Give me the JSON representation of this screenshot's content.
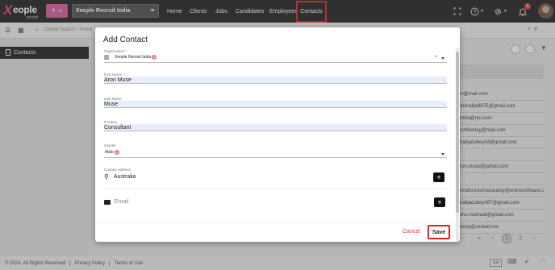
{
  "app": {
    "logo_letter": "X",
    "logo_word": "eople",
    "logo_sub": "recruit",
    "org_selector": "Xeople Recruit India"
  },
  "nav": {
    "home": "Home",
    "clients": "Clients",
    "jobs": "Jobs",
    "candidates": "Candidates",
    "employees": "Employees",
    "contacts": "Contacts"
  },
  "topbar": {
    "notification_count": "5"
  },
  "search": {
    "placeholder": "Global Search - Some"
  },
  "sidebar": {
    "contacts": "Contacts"
  },
  "background_list": {
    "emails": [
      "ni@mail.com",
      "atshailja9875@gmail.com",
      "nkita@nui.com",
      "notherday@mail.com",
      "hailjadubey34@gmail.com",
      "",
      "ron.muse@yahoo.com",
      "",
      "nnidhi.krishnaswamy@entiresoftware.c",
      "hailjadubey087@gmail.com",
      "shu.mainwal@gmail.com",
      "onny@contact.mn"
    ],
    "pager": {
      "prev_first": "«",
      "prev": "‹",
      "current": "1",
      "next_page": "2",
      "next": "›"
    }
  },
  "footer": {
    "copyright": "© 2024. All Rights Reserved",
    "privacy": "Privacy Policy",
    "terms": "Terms of Use",
    "lang": "GA"
  },
  "modal": {
    "title": "Add Contact",
    "organisation": {
      "label": "Organisation *",
      "value": "Xeople Recruit India"
    },
    "first_name": {
      "label": "First Name *",
      "value": "Aron Muse"
    },
    "last_name": {
      "label": "Last Name",
      "value": "Muse"
    },
    "position": {
      "label": "Position",
      "value": "Consultant"
    },
    "gender": {
      "label": "Gender",
      "value": "Male"
    },
    "contact_address": {
      "label": "Contact Address",
      "value": "Australia"
    },
    "email": {
      "placeholder": "Email"
    },
    "cancel_label": "Cancel",
    "save_label": "Save"
  },
  "colors": {
    "accent": "#d6589c",
    "highlight_border": "#e01e26",
    "topbar": "#1b1b1b",
    "cancel": "#d23c3c"
  }
}
